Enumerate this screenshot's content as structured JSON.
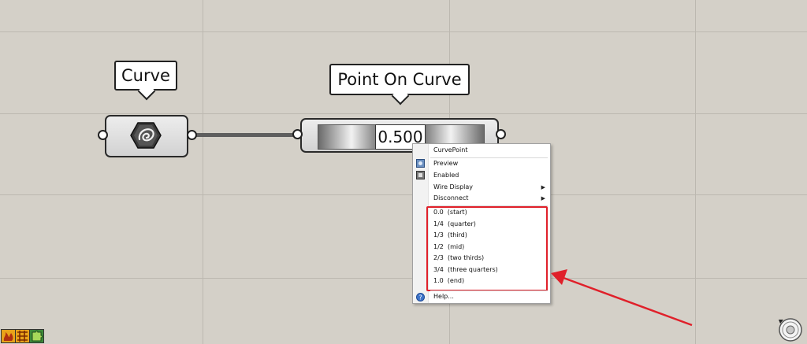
{
  "canvas": {
    "background": "#d4d0c8",
    "grid_color": "#bcb8b0"
  },
  "curve_component": {
    "label": "Curve",
    "icon": "curve-param-icon"
  },
  "point_on_curve": {
    "label": "Point On Curve",
    "value": "0.500"
  },
  "context_menu": {
    "title": "CurvePoint",
    "items": [
      {
        "label": "Preview",
        "icon": "preview-icon"
      },
      {
        "label": "Enabled",
        "icon": "enabled-icon"
      },
      {
        "label": "Wire Display",
        "submenu": true
      },
      {
        "label": "Disconnect",
        "submenu": true
      }
    ],
    "presets": [
      "0.0  (start)",
      "1/4  (quarter)",
      "1/3  (third)",
      "1/2  (mid)",
      "2/3  (two thirds)",
      "3/4  (three quarters)",
      "1.0  (end)"
    ],
    "help": "Help...",
    "highlight_color": "#e0202a"
  },
  "annotation": {
    "arrow_color": "#e0202a"
  },
  "toolbar_icons": [
    "flame-icon",
    "flame-grid-icon",
    "puzzle-icon"
  ],
  "corner_widget": "navigation-dial-icon"
}
